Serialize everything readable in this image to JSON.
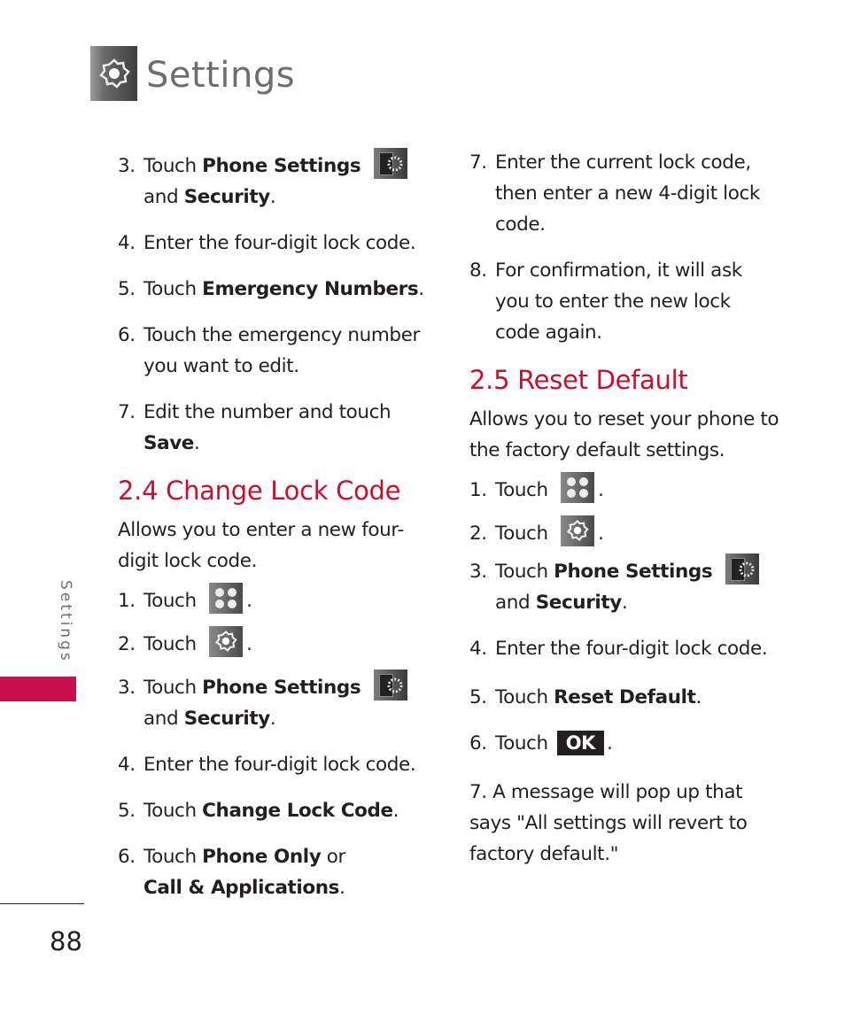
{
  "header": {
    "title": "Settings",
    "icon": "settings-gear-icon"
  },
  "sidebar": {
    "label": "Settings",
    "accent_color": "#c8104f"
  },
  "page_number": "88",
  "left_column": {
    "steps_top": [
      {
        "num": "3.",
        "parts": [
          "Touch ",
          "Phone Settings",
          " [icon] and ",
          "Security",
          "."
        ],
        "pre": "Touch ",
        "bold1": "Phone Settings",
        "mid": "and ",
        "bold2": "Security",
        "post": ".",
        "icon": "phone-settings-icon"
      },
      {
        "num": "4.",
        "text": "Enter the four-digit lock code."
      },
      {
        "num": "5.",
        "pre": "Touch ",
        "bold": "Emergency Numbers",
        "post": "."
      },
      {
        "num": "6.",
        "text": "Touch the emergency number you want to edit."
      },
      {
        "num": "7.",
        "pre": "Edit the number and touch ",
        "bold": "Save",
        "post": "."
      }
    ],
    "section": {
      "title": "2.4 Change Lock Code",
      "intro": "Allows you to enter a new four-digit lock code.",
      "steps": [
        {
          "num": "1.",
          "pre": "Touch",
          "icon": "menu-grid-icon",
          "post": "."
        },
        {
          "num": "2.",
          "pre": "Touch",
          "icon": "settings-gear-icon",
          "post": "."
        },
        {
          "num": "3.",
          "pre": "Touch ",
          "bold1": "Phone Settings",
          "mid": "and ",
          "bold2": "Security",
          "post": ".",
          "icon": "phone-settings-icon"
        },
        {
          "num": "4.",
          "text": "Enter the four-digit lock code."
        },
        {
          "num": "5.",
          "pre": "Touch ",
          "bold": "Change Lock Code",
          "post": "."
        },
        {
          "num": "6.",
          "pre": "Touch ",
          "bold1": "Phone Only",
          "mid": " or ",
          "bold2": "Call & Applications",
          "post": "."
        }
      ]
    }
  },
  "right_column": {
    "steps_top": [
      {
        "num": "7.",
        "text": "Enter the current lock code, then enter a new 4-digit lock code."
      },
      {
        "num": "8.",
        "text": "For confirmation, it will ask you to enter the new lock code again."
      }
    ],
    "section": {
      "title": "2.5 Reset Default",
      "intro": "Allows you to reset your phone to the factory default settings.",
      "steps": [
        {
          "num": "1.",
          "pre": "Touch",
          "icon": "menu-grid-icon",
          "post": "."
        },
        {
          "num": "2.",
          "pre": "Touch",
          "icon": "settings-gear-icon",
          "post": "."
        },
        {
          "num": "3.",
          "pre": "Touch ",
          "bold1": "Phone Settings",
          "mid": "and ",
          "bold2": "Security",
          "post": ".",
          "icon": "phone-settings-icon"
        },
        {
          "num": "4.",
          "text": "Enter the four-digit lock code."
        },
        {
          "num": "5.",
          "pre": "Touch ",
          "bold": "Reset Default",
          "post": "."
        },
        {
          "num": "6.",
          "pre": "Touch",
          "ok": "OK",
          "post": "."
        },
        {
          "num": "7.",
          "text": "A message will pop up that says \"All settings will revert to factory default.\""
        }
      ]
    }
  },
  "colors": {
    "heading": "#c8102e",
    "title_gray": "#6d6e71",
    "text": "#231f20"
  }
}
